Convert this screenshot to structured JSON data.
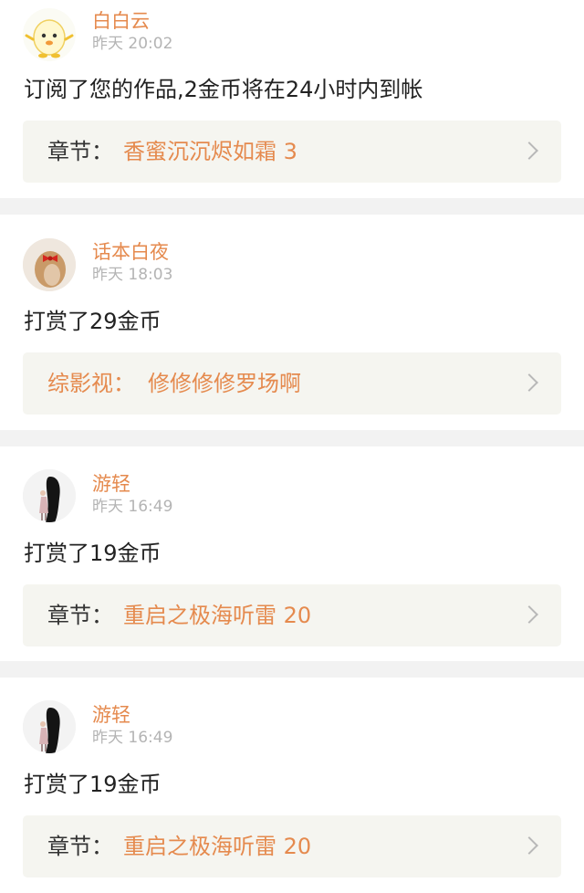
{
  "posts": [
    {
      "user": "白白云",
      "time": "昨天 20:02",
      "message": "订阅了您的作品,2金币将在24小时内到帐",
      "link_prefix": "章节：",
      "link_title": "香蜜沉沉烬如霜 3",
      "avatar": "egg-mascot-avatar"
    },
    {
      "user": "话本白夜",
      "time": "昨天 18:03",
      "message": "打赏了29金币",
      "link_prefix": "综影视：",
      "link_title": "修修修修罗场啊",
      "avatar": "girl-bow-avatar"
    },
    {
      "user": "游轻",
      "time": "昨天 16:49",
      "message": "打赏了19金币",
      "link_prefix": "章节：",
      "link_title": "重启之极海听雷 20",
      "avatar": "long-hair-girl-avatar"
    },
    {
      "user": "游轻",
      "time": "昨天 16:49",
      "message": "打赏了19金币",
      "link_prefix": "章节：",
      "link_title": "重启之极海听雷 20",
      "avatar": "long-hair-girl-avatar"
    }
  ],
  "colors": {
    "accent": "#e58a4e",
    "background": "#f2f2f2",
    "link_box": "#f5f5f0"
  }
}
